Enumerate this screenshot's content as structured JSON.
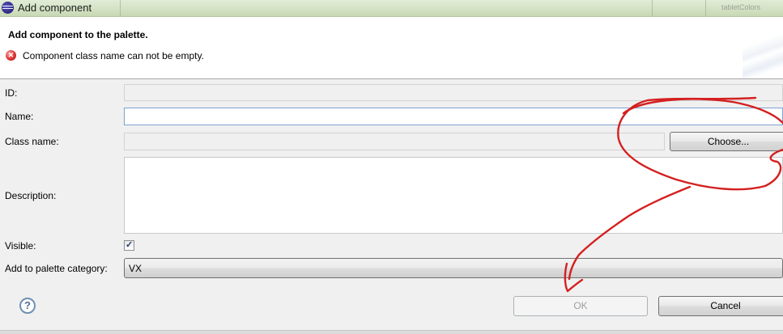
{
  "window": {
    "title": "Add component",
    "background_label": "tabletColors"
  },
  "header": {
    "title": "Add component to the palette.",
    "error_message": "Component class name can not be empty."
  },
  "form": {
    "id_label": "ID:",
    "id_value": "",
    "name_label": "Name:",
    "name_value": "",
    "class_name_label": "Class name:",
    "class_name_value": "",
    "choose_button": "Choose...",
    "description_label": "Description:",
    "description_value": "",
    "visible_label": "Visible:",
    "visible_checked": true,
    "category_label": "Add to palette category:",
    "category_value": "VX"
  },
  "footer": {
    "ok_button": "OK",
    "cancel_button": "Cancel"
  },
  "icons": {
    "app": "eclipse-icon",
    "error": "error-icon",
    "help": "help-icon"
  },
  "colors": {
    "annotation": "#d42020",
    "error": "#d33333",
    "title_bar": "#d4e2c4"
  }
}
